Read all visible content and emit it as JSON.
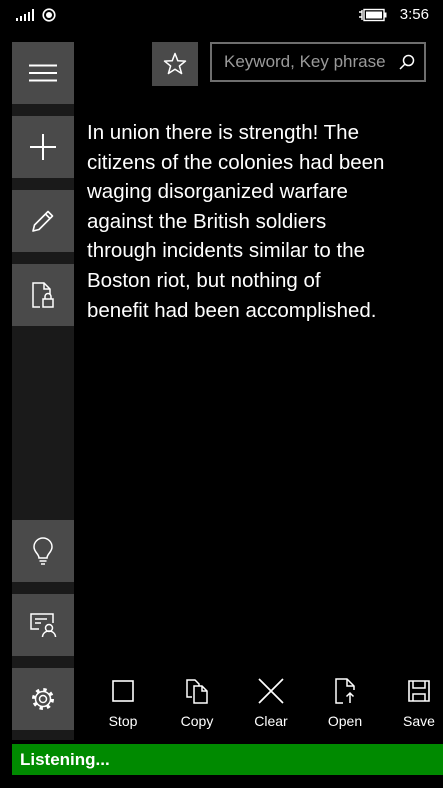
{
  "status_bar": {
    "time": "3:56",
    "icons": [
      "signal-icon",
      "data-connection-icon",
      "battery-charging-icon"
    ]
  },
  "toolbar": {
    "favorites_icon": "star-icon",
    "search": {
      "placeholder": "Keyword, Key phrase",
      "value": "",
      "icon": "search-icon"
    }
  },
  "sidebar": {
    "items": [
      {
        "name": "menu",
        "icon": "hamburger-icon"
      },
      {
        "name": "new",
        "icon": "plus-icon"
      },
      {
        "name": "edit",
        "icon": "pencil-icon"
      },
      {
        "name": "protected-document",
        "icon": "document-lock-icon"
      },
      {
        "name": "tips",
        "icon": "lightbulb-icon"
      },
      {
        "name": "presenter",
        "icon": "presenter-icon"
      },
      {
        "name": "settings",
        "icon": "gear-icon"
      }
    ]
  },
  "content": {
    "text": "In union there is strength! The\ncitizens of the colonies had been\nwaging disorganized warfare\nagainst the British soldiers\nthrough incidents similar to the\nBoston riot, but nothing of\nbenefit had been accomplished."
  },
  "commands": [
    {
      "label": "Stop",
      "icon": "stop-icon"
    },
    {
      "label": "Copy",
      "icon": "copy-icon"
    },
    {
      "label": "Clear",
      "icon": "close-icon"
    },
    {
      "label": "Open",
      "icon": "open-file-icon"
    },
    {
      "label": "Save",
      "icon": "save-icon"
    }
  ],
  "status": {
    "text": "Listening...",
    "color": "#008a00"
  }
}
